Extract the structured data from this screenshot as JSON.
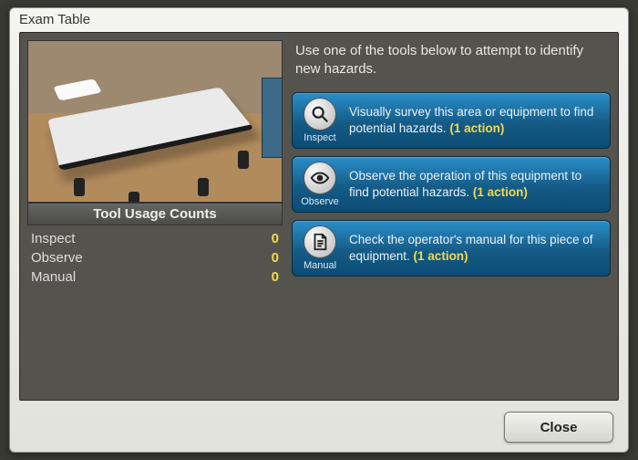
{
  "window": {
    "title": "Exam Table"
  },
  "preview": {
    "subject": "hospital-exam-table"
  },
  "counts": {
    "header": "Tool Usage Counts",
    "rows": [
      {
        "label": "Inspect",
        "value": "0"
      },
      {
        "label": "Observe",
        "value": "0"
      },
      {
        "label": "Manual",
        "value": "0"
      }
    ]
  },
  "instructions": "Use one of the tools below to attempt to identify new hazards.",
  "tools": [
    {
      "id": "inspect",
      "label": "Inspect",
      "icon": "magnifier-icon",
      "desc": "Visually survey this area or equipment to find potential hazards.",
      "cost": "(1 action)"
    },
    {
      "id": "observe",
      "label": "Observe",
      "icon": "eye-icon",
      "desc": "Observe the operation of this equipment to find potential hazards.",
      "cost": "(1 action)"
    },
    {
      "id": "manual",
      "label": "Manual",
      "icon": "document-icon",
      "desc": "Check the operator's manual for this piece of equipment.",
      "cost": "(1 action)"
    }
  ],
  "buttons": {
    "close": "Close"
  },
  "colors": {
    "accent": "#f2d94e",
    "tool_bg": "#1a6fa3",
    "panel": "#55534e"
  }
}
